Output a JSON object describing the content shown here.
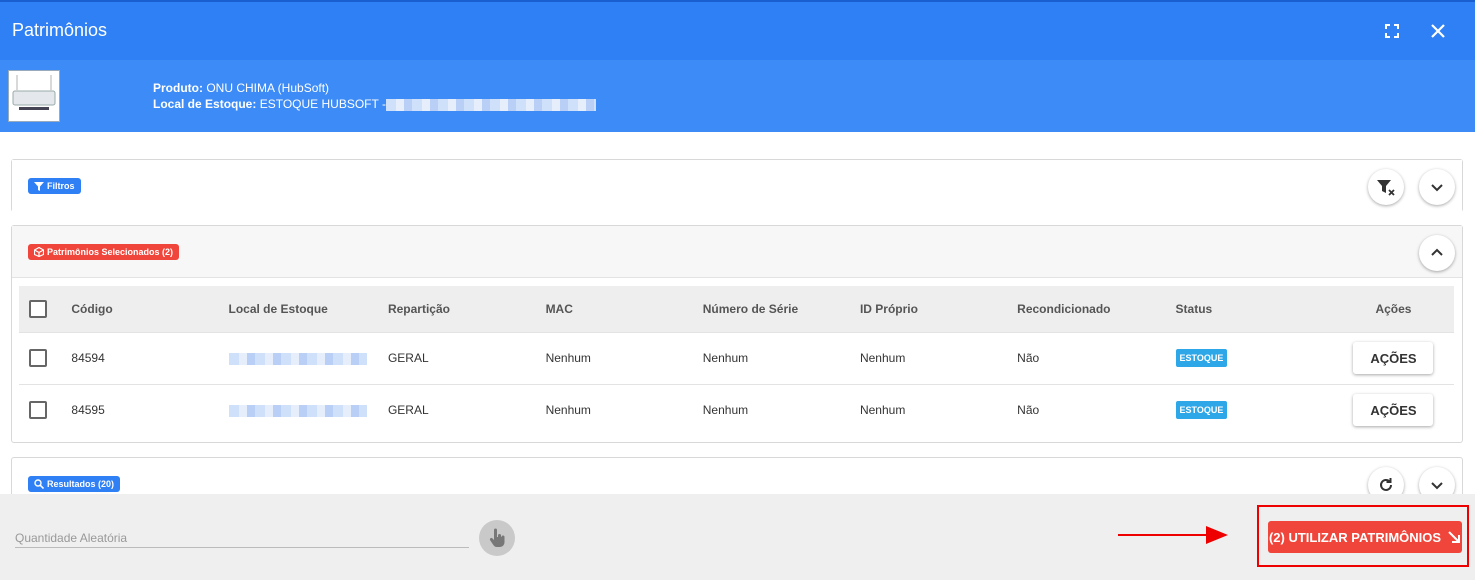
{
  "window": {
    "title": "Patrimônios"
  },
  "product": {
    "label_produto": "Produto:",
    "produto": "ONU CHIMA (HubSoft)",
    "label_local": "Local de Estoque:",
    "local": "ESTOQUE HUBSOFT -"
  },
  "filtros": {
    "label": "Filtros"
  },
  "selecionados": {
    "label": "Patrimônios Selecionados (2)",
    "columns": [
      "Código",
      "Local de Estoque",
      "Repartição",
      "MAC",
      "Número de Série",
      "ID Próprio",
      "Recondicionado",
      "Status",
      "Ações"
    ],
    "rows": [
      {
        "codigo": "84594",
        "reparticao": "GERAL",
        "mac": "Nenhum",
        "serie": "Nenhum",
        "id_proprio": "Nenhum",
        "recondicionado": "Não",
        "status": "ESTOQUE",
        "acoes": "AÇÕES"
      },
      {
        "codigo": "84595",
        "reparticao": "GERAL",
        "mac": "Nenhum",
        "serie": "Nenhum",
        "id_proprio": "Nenhum",
        "recondicionado": "Não",
        "status": "ESTOQUE",
        "acoes": "AÇÕES"
      }
    ]
  },
  "resultados": {
    "label": "Resultados (20)"
  },
  "footer": {
    "quantidade_placeholder": "Quantidade Aleatória",
    "utilizar_label": "(2) UTILIZAR PATRIMÔNIOS"
  },
  "colors": {
    "primary": "#2f7ff5",
    "danger": "#f0453a",
    "status": "#2ea7e8"
  }
}
